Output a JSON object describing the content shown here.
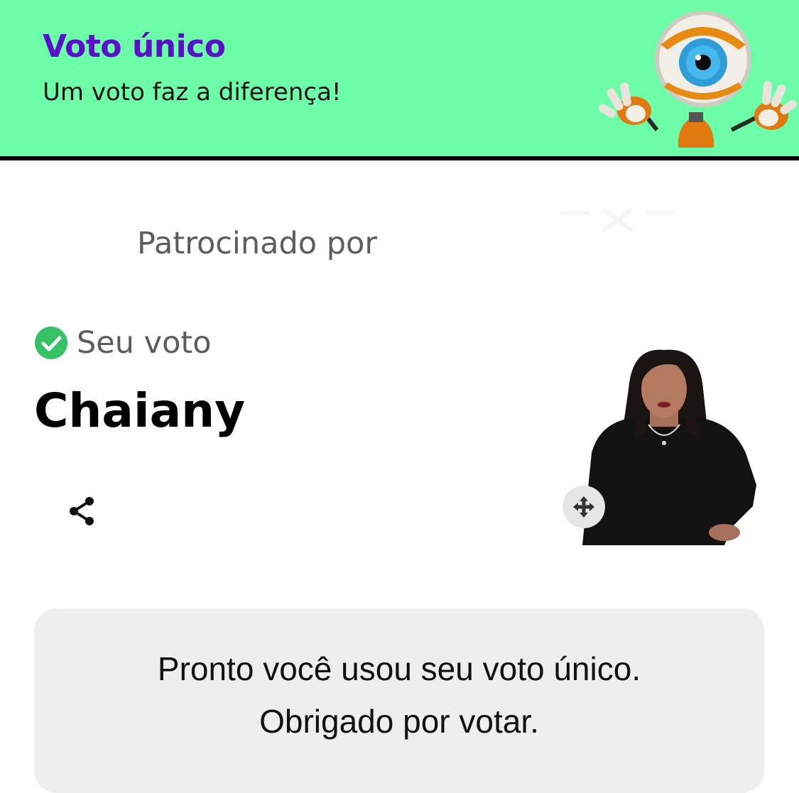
{
  "header": {
    "title": "Voto único",
    "subtitle": "Um voto faz a diferença!",
    "mascot_icon": "big-brother-eye-robot-icon",
    "background_color": "#6dfda8",
    "title_color": "#5a0fc8"
  },
  "sponsor": {
    "label": "Patrocinado por",
    "logo_icon": "sponsor-logo-icon"
  },
  "vote": {
    "status_label": "Seu voto",
    "status_icon": "check-circle-icon",
    "status_color": "#34c264",
    "candidate_name": "Chaiany",
    "share_icon": "share-icon",
    "move_icon": "move-arrows-icon"
  },
  "confirmation": {
    "line1": "Pronto você usou seu voto único.",
    "line2": "Obrigado por votar."
  }
}
